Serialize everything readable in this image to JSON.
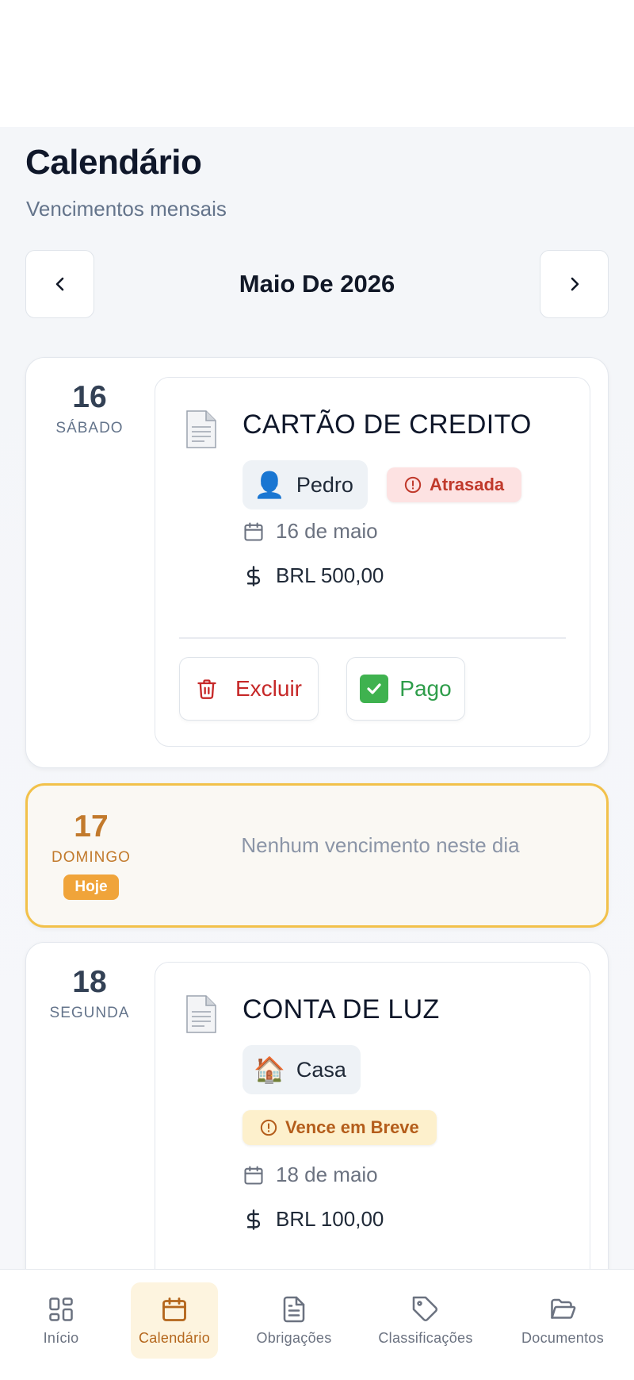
{
  "header": {
    "title": "Calendário",
    "subtitle": "Vencimentos mensais"
  },
  "month_nav": {
    "label": "Maio De 2026",
    "prev_icon": "chevron-left-icon",
    "next_icon": "chevron-right-icon"
  },
  "days": [
    {
      "number": "16",
      "weekday": "SÁBADO",
      "entries": [
        {
          "title": "CARTÃO DE CREDITO",
          "icon": "document-icon",
          "classification": {
            "emoji": "👤",
            "label": "Pedro"
          },
          "status": {
            "label": "Atrasada",
            "color": "#c0392b"
          },
          "date": "16 de maio",
          "amount": "BRL 500,00",
          "actions": {
            "delete": "Excluir",
            "paid": "Pago"
          }
        }
      ]
    },
    {
      "number": "17",
      "weekday": "DOMINGO",
      "today_label": "Hoje",
      "empty_message": "Nenhum vencimento neste dia"
    },
    {
      "number": "18",
      "weekday": "SEGUNDA",
      "entries": [
        {
          "title": "CONTA DE LUZ",
          "icon": "document-icon",
          "classification": {
            "emoji": "🏠",
            "label": "Casa"
          },
          "status": {
            "label": "Vence em Breve",
            "color": "#b45d1b"
          },
          "date": "18 de maio",
          "amount": "BRL 100,00"
        }
      ]
    }
  ],
  "bottom_nav": {
    "tabs": [
      {
        "label": "Início",
        "icon": "grid-icon",
        "active": false
      },
      {
        "label": "Calendário",
        "icon": "calendar-icon",
        "active": true
      },
      {
        "label": "Obrigações",
        "icon": "file-text-icon",
        "active": false
      },
      {
        "label": "Classificações",
        "icon": "tag-icon",
        "active": false
      },
      {
        "label": "Documentos",
        "icon": "folder-open-icon",
        "active": false
      }
    ]
  },
  "colors": {
    "accent": "#f0a43a",
    "active_tab": "#b4661c",
    "overdue": "#c0392b",
    "due_soon": "#b45d1b",
    "paid": "#2e9d4a"
  }
}
